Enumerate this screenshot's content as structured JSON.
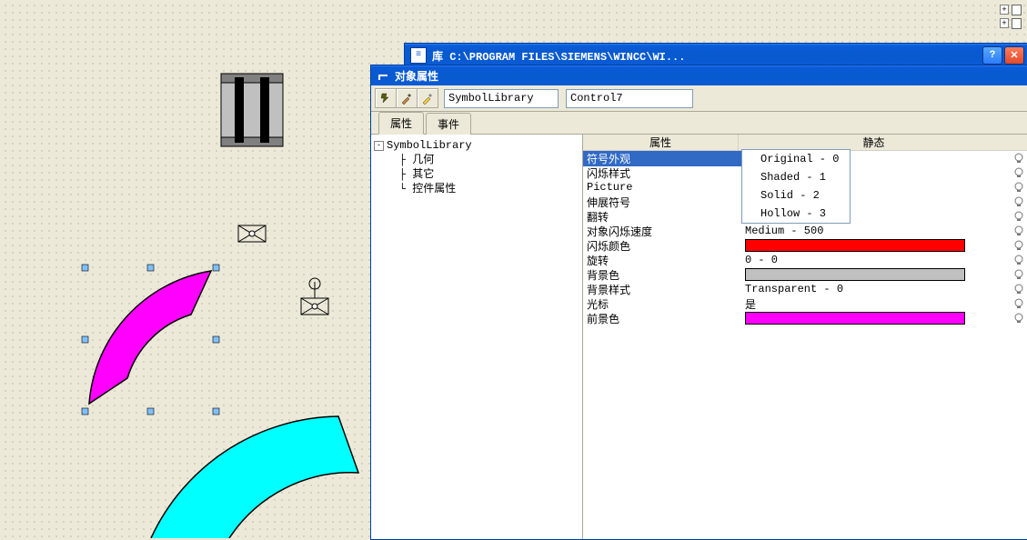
{
  "library_window": {
    "title": "库  C:\\PROGRAM FILES\\SIEMENS\\WINCC\\WI..."
  },
  "props_window": {
    "title": "对象属性",
    "object_type": "SymbolLibrary",
    "object_name": "Control7",
    "tabs": {
      "active": "属性",
      "inactive": "事件"
    },
    "tree": {
      "root": "SymbolLibrary",
      "children": [
        "几何",
        "其它",
        "控件属性"
      ]
    },
    "grid_headers": {
      "attr": "属性",
      "static": "静态"
    },
    "rows": {
      "r0": {
        "attr": "符号外观"
      },
      "r1": {
        "attr": "闪烁样式"
      },
      "r2": {
        "attr": "Picture"
      },
      "r3": {
        "attr": "伸展符号"
      },
      "r4": {
        "attr": "翻转"
      },
      "r5": {
        "attr": "对象闪烁速度",
        "val": "Medium - 500"
      },
      "r6": {
        "attr": "闪烁颜色"
      },
      "r7": {
        "attr": "旋转",
        "val": "0 - 0"
      },
      "r8": {
        "attr": "背景色"
      },
      "r9": {
        "attr": "背景样式",
        "val": "Transparent - 0"
      },
      "r10": {
        "attr": "光标",
        "val": "是"
      },
      "r11": {
        "attr": "前景色"
      }
    },
    "dropdown": {
      "items": [
        "Original - 0",
        "Shaded - 1",
        "Solid - 2",
        "Hollow - 3"
      ]
    }
  }
}
